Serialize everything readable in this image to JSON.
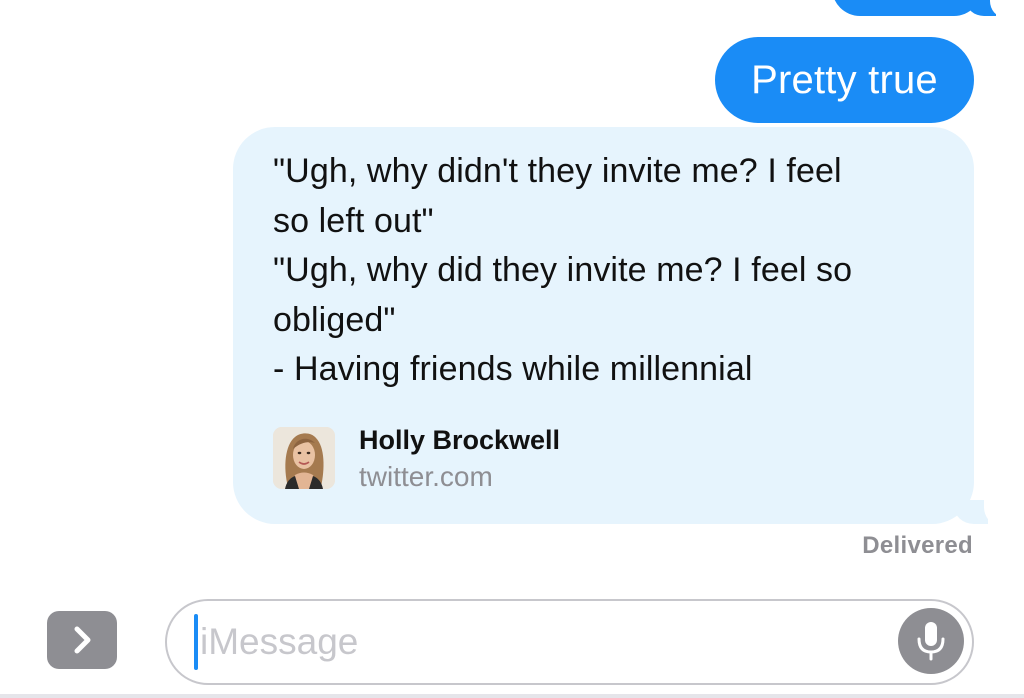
{
  "conversation": {
    "sent_message": "Pretty true",
    "link_preview": {
      "quote_lines": [
        "\"Ugh, why didn't they invite me? I feel",
        "so left out\"",
        "\"Ugh, why did they invite me? I feel so",
        "obliged\"",
        "- Having friends while millennial"
      ],
      "author": "Holly Brockwell",
      "domain": "twitter.com",
      "avatar_icon": "profile-photo"
    },
    "delivery_status": "Delivered"
  },
  "composer": {
    "expand_icon": "chevron-right-icon",
    "placeholder": "iMessage",
    "mic_icon": "microphone-icon"
  },
  "colors": {
    "sent_bubble": "#1a8cf6",
    "link_bubble": "#e6f4fd",
    "secondary_text": "#8e8e93",
    "input_border": "#c7c7cc"
  }
}
